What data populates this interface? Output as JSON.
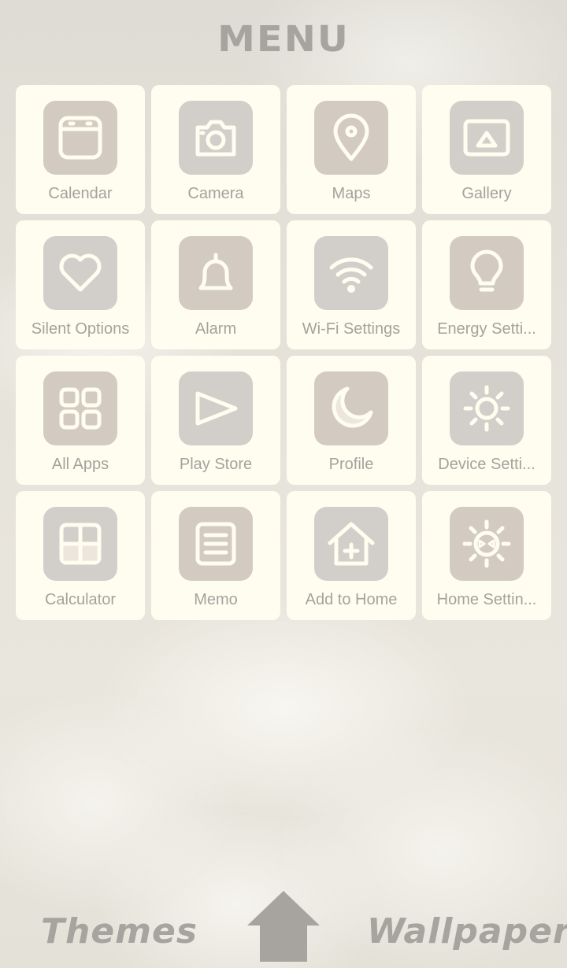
{
  "header": {
    "title": "MENU"
  },
  "apps": [
    {
      "label": "Calendar",
      "icon": "calendar-icon"
    },
    {
      "label": "Camera",
      "icon": "camera-icon"
    },
    {
      "label": "Maps",
      "icon": "map-pin-icon"
    },
    {
      "label": "Gallery",
      "icon": "gallery-icon"
    },
    {
      "label": "Silent Options",
      "icon": "heart-icon"
    },
    {
      "label": "Alarm",
      "icon": "bell-icon"
    },
    {
      "label": "Wi-Fi Settings",
      "icon": "wifi-icon"
    },
    {
      "label": "Energy Setti...",
      "icon": "lightbulb-icon"
    },
    {
      "label": "All Apps",
      "icon": "grid-icon"
    },
    {
      "label": "Play Store",
      "icon": "play-icon"
    },
    {
      "label": "Profile",
      "icon": "moon-icon"
    },
    {
      "label": "Device Setti...",
      "icon": "sun-gear-icon"
    },
    {
      "label": "Calculator",
      "icon": "calculator-icon"
    },
    {
      "label": "Memo",
      "icon": "memo-icon"
    },
    {
      "label": "Add to Home",
      "icon": "add-home-icon"
    },
    {
      "label": "Home Settin...",
      "icon": "home-settings-icon"
    }
  ],
  "bottom_bar": {
    "themes_label": "Themes",
    "wallpapers_label": "Wallpapers",
    "home_icon": "home-icon"
  },
  "colors": {
    "tile_background": "#fffdf0",
    "icon_box_beige": "#d3cbc1",
    "icon_box_grey": "#d2cfca",
    "label_text": "#a5a29c",
    "title_text": "#a7a39e"
  }
}
